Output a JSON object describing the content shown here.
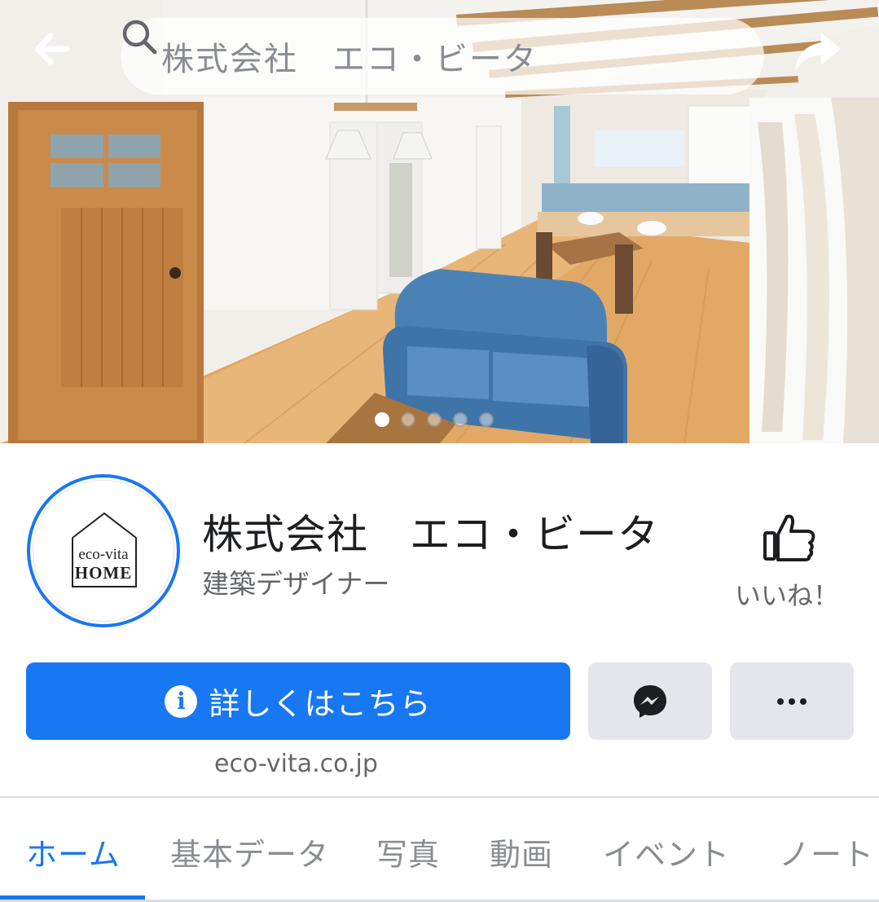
{
  "header": {
    "search_text": "株式会社　エコ・ビータ",
    "icons": [
      "back-arrow-icon",
      "search-icon",
      "share-icon"
    ]
  },
  "cover": {
    "photo": "living room with blue sofa, wooden door and kitchen",
    "slide_count": 5,
    "active_slide": 1
  },
  "profile": {
    "logo_line1": "eco-vita",
    "logo_line2": "HOME",
    "name": "株式会社　エコ・ビータ",
    "category": "建築デザイナー",
    "like_label": "いいね！",
    "website": "eco-vita.co.jp"
  },
  "actions": {
    "primary_label": "詳しくはこちら",
    "primary_icon": "info-icon",
    "messenger_icon": "messenger-icon",
    "more_icon": "more-dots-icon"
  },
  "tabs": [
    {
      "label": "ホーム",
      "active": true
    },
    {
      "label": "基本データ",
      "active": false
    },
    {
      "label": "写真",
      "active": false
    },
    {
      "label": "動画",
      "active": false
    },
    {
      "label": "イベント",
      "active": false
    },
    {
      "label": "ノート",
      "active": false
    }
  ],
  "colors": {
    "accent": "#1877f2",
    "secondary_text": "#65676b",
    "button_grey": "#e4e6eb"
  }
}
